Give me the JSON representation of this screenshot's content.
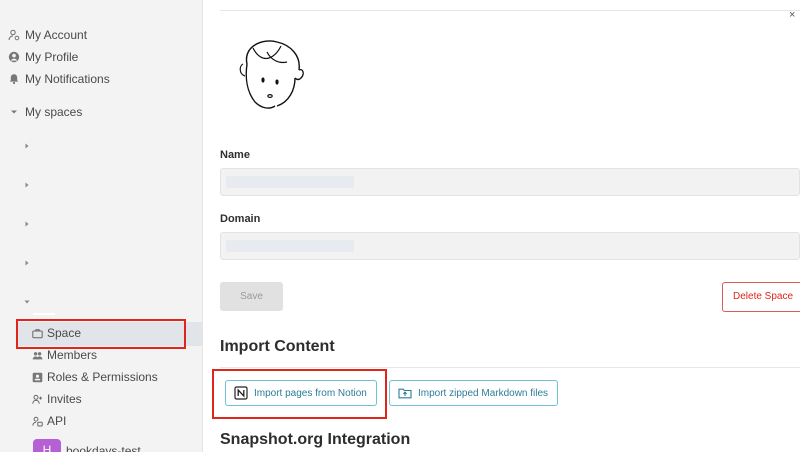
{
  "sidebar": {
    "items": [
      {
        "label": "My Account",
        "icon": "user-cog-icon"
      },
      {
        "label": "My Profile",
        "icon": "user-circle-icon"
      },
      {
        "label": "My Notifications",
        "icon": "bell-icon"
      }
    ],
    "spaces_label": "My spaces",
    "space_menu": [
      {
        "label": "Space",
        "icon": "briefcase-icon"
      },
      {
        "label": "Members",
        "icon": "users-icon"
      },
      {
        "label": "Roles & Permissions",
        "icon": "id-card-icon"
      },
      {
        "label": "Invites",
        "icon": "user-plus-icon"
      },
      {
        "label": "API",
        "icon": "api-user-icon"
      }
    ],
    "space_avatar_letter": "H",
    "space_name": "bookdays-test"
  },
  "main": {
    "name_label": "Name",
    "domain_label": "Domain",
    "save_label": "Save",
    "delete_label": "Delete Space",
    "import_heading": "Import Content",
    "import_notion_label": "Import pages from Notion",
    "import_markdown_label": "Import zipped Markdown files",
    "snapshot_heading": "Snapshot.org Integration",
    "close_glyph": "×"
  },
  "colors": {
    "accent": "#2b7d98",
    "danger": "#e0251b",
    "highlight_box": "#e0251b",
    "space_avatar": "#b660d6"
  }
}
